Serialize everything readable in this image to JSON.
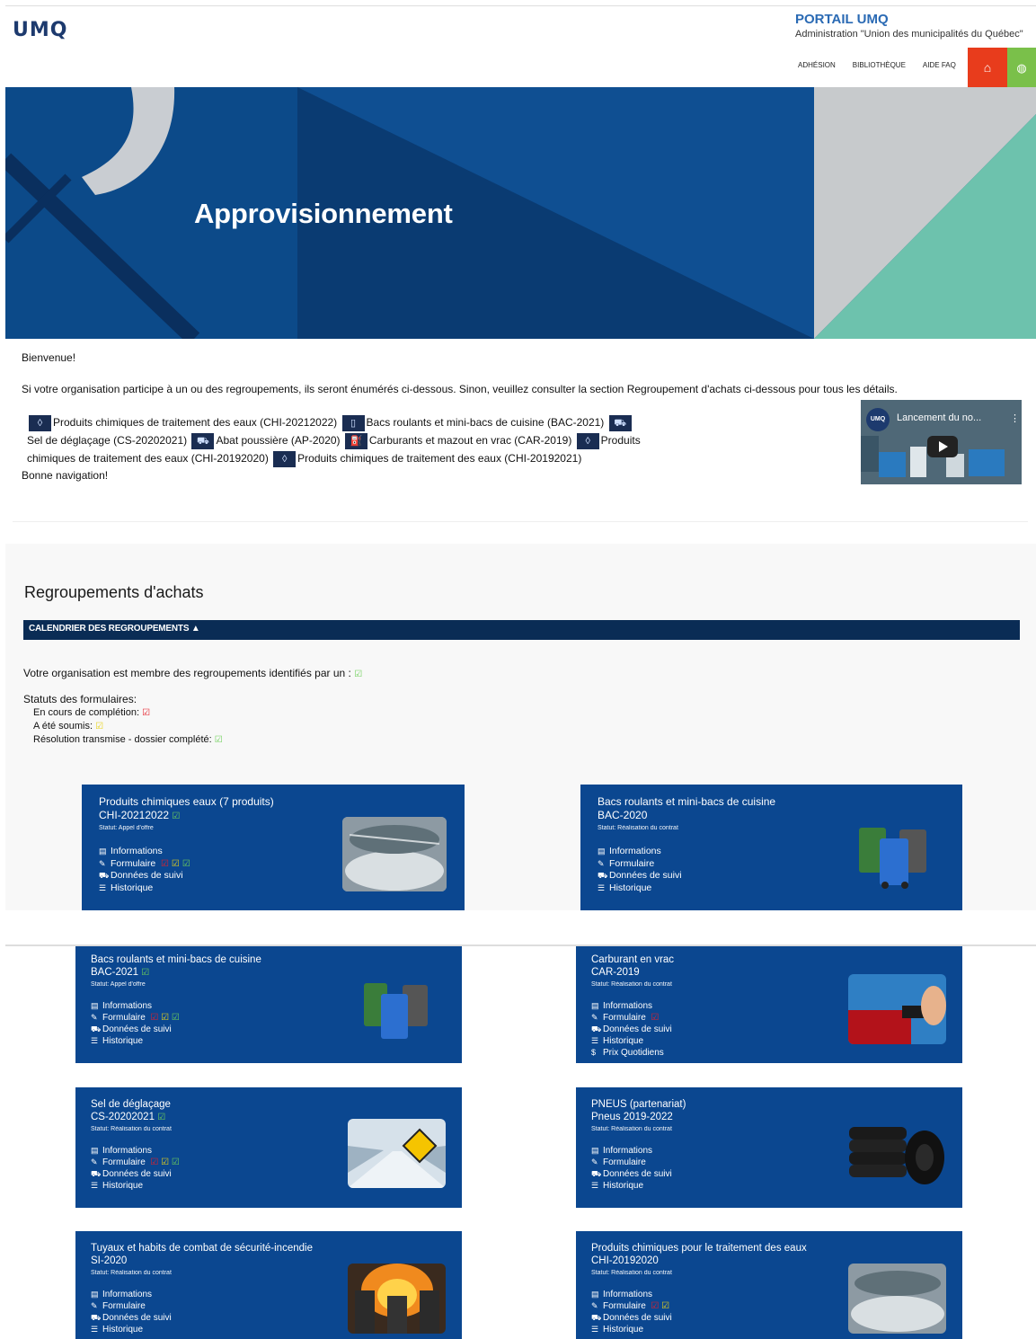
{
  "header": {
    "logo": "UMQ",
    "portal_title": "PORTAIL UMQ",
    "portal_subtitle": "Administration \"Union des municipalités du Québec\"",
    "nav": [
      "ADHÉSION",
      "BIBLIOTHÈQUE",
      "AIDE FAQ"
    ],
    "home_icon": "home-icon",
    "globe_icon": "globe-icon"
  },
  "hero": {
    "title": "Approvisionnement"
  },
  "intro": {
    "welcome": "Bienvenue!",
    "text": "Si votre organisation participe à un ou des regroupements, ils seront énumérés ci-dessous. Sinon, veuillez consulter la section Regroupement d'achats ci-dessous pour tous les détails.",
    "groups": [
      "Produits chimiques de traitement des eaux (CHI-20212022)",
      "Bacs roulants et mini-bacs de cuisine (BAC-2021)",
      "Sel de déglaçage (CS-20202021)",
      "Abat poussière (AP-2020)",
      "Carburants et mazout en vrac (CAR-2019)",
      "Produits chimiques de traitement des eaux (CHI-20192020)",
      "Produits chimiques de traitement des eaux (CHI-20192021)"
    ],
    "closing": "Bonne navigation!"
  },
  "video": {
    "title": "Lancement du no...",
    "logo": "UMQ"
  },
  "purchasing": {
    "title": "Regroupements d'achats",
    "calendar_bar": "CALENDRIER DES REGROUPEMENTS",
    "member_text": "Votre organisation est membre des regroupements identifiés par un :",
    "status_heading": "Statuts des formulaires:",
    "status_in_progress": "En cours de complétion:",
    "status_submitted": "A été soumis:",
    "status_complete": "Résolution transmise - dossier complété:"
  },
  "cards": [
    {
      "title": "Produits chimiques eaux (7 produits)",
      "code": "CHI-20212022",
      "status": "Statut: Appel d'offre",
      "links": [
        "Informations",
        "Formulaire",
        "Données de suivi",
        "Historique"
      ]
    },
    {
      "title": "Bacs roulants et mini-bacs de cuisine",
      "code": "BAC-2020",
      "status": "Statut: Réalisation du contrat",
      "links": [
        "Informations",
        "Formulaire",
        "Données de suivi",
        "Historique"
      ]
    },
    {
      "title": "Bacs roulants et mini-bacs de cuisine",
      "code": "BAC-2021",
      "status": "Statut: Appel d'offre",
      "links": [
        "Informations",
        "Formulaire",
        "Données de suivi",
        "Historique"
      ]
    },
    {
      "title": "Carburant en vrac",
      "code": "CAR-2019",
      "status": "Statut: Réalisation du contrat",
      "links": [
        "Informations",
        "Formulaire",
        "Données de suivi",
        "Historique",
        "Prix Quotidiens"
      ]
    },
    {
      "title": "Sel de déglaçage",
      "code": "CS-20202021",
      "status": "Statut: Réalisation du contrat",
      "links": [
        "Informations",
        "Formulaire",
        "Données de suivi",
        "Historique"
      ]
    },
    {
      "title": "PNEUS (partenariat)",
      "code": "Pneus 2019-2022",
      "status": "Statut: Réalisation du contrat",
      "links": [
        "Informations",
        "Formulaire",
        "Données de suivi",
        "Historique"
      ]
    },
    {
      "title": "Tuyaux et habits de combat de sécurité-incendie",
      "code": "SI-2020",
      "status": "Statut: Réalisation du contrat",
      "links": [
        "Informations",
        "Formulaire",
        "Données de suivi",
        "Historique"
      ]
    },
    {
      "title": "Produits chimiques pour le traitement des eaux",
      "code": "CHI-20192020",
      "status": "Statut: Réalisation du contrat",
      "links": [
        "Informations",
        "Formulaire",
        "Données de suivi",
        "Historique"
      ]
    }
  ],
  "colors": {
    "navy": "#0a2c55",
    "card_blue": "#0b4790",
    "home_red": "#e83c1c",
    "globe_green": "#7ac04a",
    "check_green": "#6fd05a",
    "check_red": "#e5202a",
    "check_yellow": "#e8d318"
  }
}
